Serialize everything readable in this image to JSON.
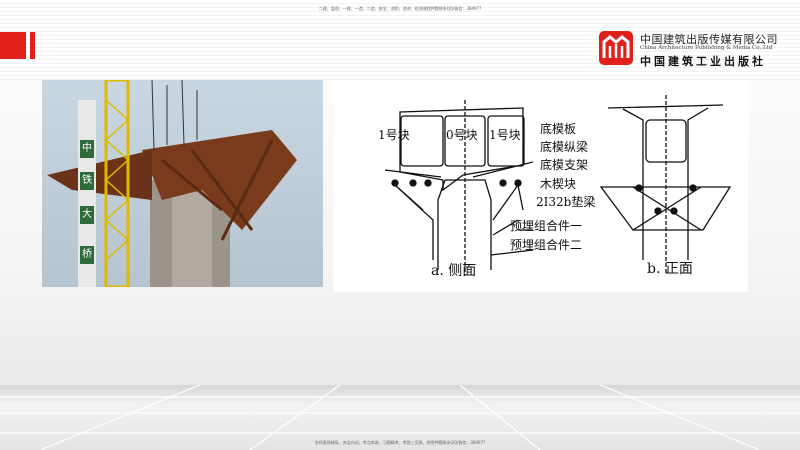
{
  "header_note": "二建、监理、一建、一造、二造、安全、消防、咨询、检测课程押题联系QQ/微信：38497?",
  "footer_note": "名师直授辅导、夹念内训、考点串讲、习题精考、考前三页纸、绝密押题联系QQ/微信：38497?",
  "logo": {
    "cn_name": "中国建筑出版传媒有限公司",
    "en_name": "China Architecture Publishing & Media Co.,Ltd",
    "cn_name2": "中国建筑工业出版社"
  },
  "photo": {
    "signs": [
      "中",
      "铁",
      "大",
      "桥"
    ]
  },
  "diagram": {
    "blocks": [
      "1号块",
      "0号块",
      "1号块"
    ],
    "labels": [
      "底模板",
      "底模纵梁",
      "底模支架",
      "木楔块",
      "2I32b垫梁",
      "预埋组合件一",
      "预埋组合件二"
    ],
    "caption_side": "a. 侧面",
    "caption_front": "b. 正面"
  },
  "colors": {
    "accent": "#e0201b"
  }
}
